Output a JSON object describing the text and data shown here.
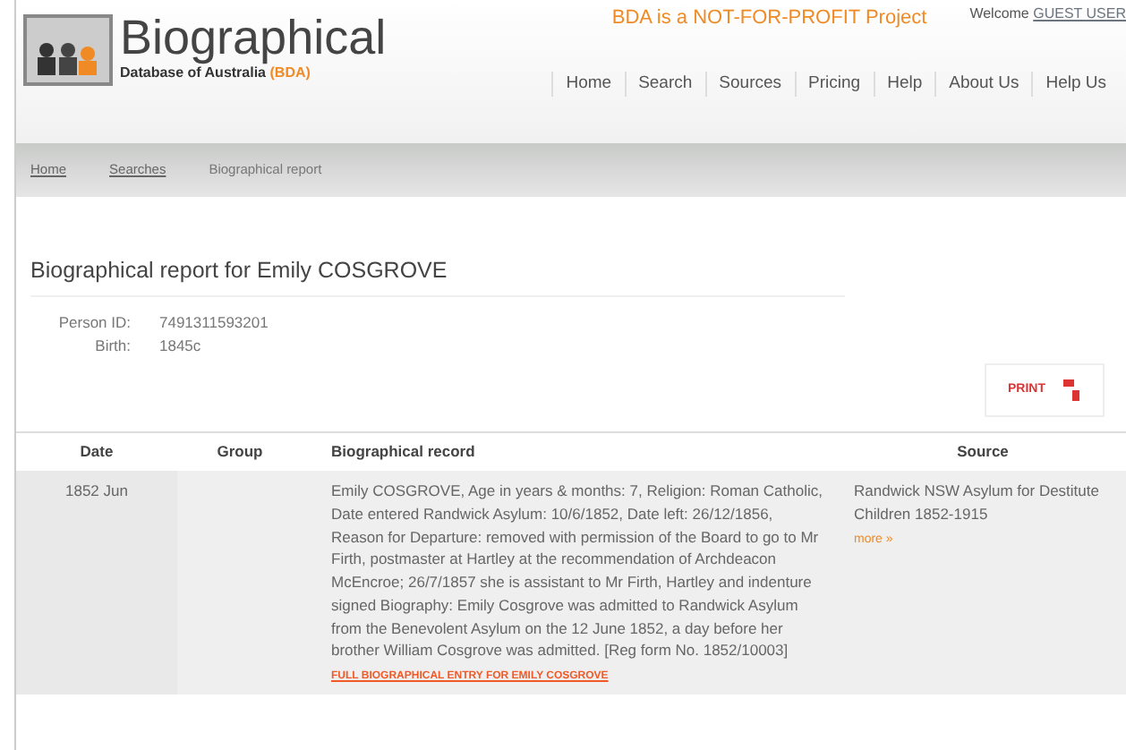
{
  "header": {
    "logo_title": "Biographical",
    "logo_subtitle": "Database of Australia",
    "logo_abbrev": "(BDA)",
    "tagline": "BDA is a NOT-FOR-PROFIT Project",
    "welcome": "Welcome",
    "user_link": "GUEST USER"
  },
  "nav": [
    {
      "label": "Home"
    },
    {
      "label": "Search"
    },
    {
      "label": "Sources"
    },
    {
      "label": "Pricing"
    },
    {
      "label": "Help"
    },
    {
      "label": "About Us"
    },
    {
      "label": "Help Us"
    }
  ],
  "breadcrumb": [
    {
      "label": "Home",
      "link": true
    },
    {
      "label": "Searches",
      "link": true
    },
    {
      "label": "Biographical report",
      "link": false
    }
  ],
  "title": "Biographical report for Emily COSGROVE",
  "details": [
    {
      "label": "Person ID:",
      "value": "7491311593201"
    },
    {
      "label": "Birth:",
      "value": "1845c"
    }
  ],
  "print_button": "PRINT",
  "table": {
    "columns": [
      "Date",
      "Group",
      "Biographical record",
      "Source"
    ],
    "rows": [
      {
        "date": "1852 Jun",
        "group": "",
        "record": "Emily COSGROVE, Age in years & months: 7, Religion: Roman Catholic, Date entered Randwick Asylum: 10/6/1852, Date left: 26/12/1856, Reason for Departure: removed with permission of the Board to go to Mr Firth, postmaster at Hartley at the recommendation of Archdeacon McEncroe; 26/7/1857 she is assistant to Mr Firth, Hartley and indenture signed Biography: Emily Cosgrove was admitted to Randwick Asylum from the Benevolent Asylum on the 12 June 1852, a day before her brother William Cosgrove was admitted. [Reg form No. 1852/10003]",
        "record_link": "FULL BIOGRAPHICAL ENTRY FOR EMILY COSGROVE",
        "source": "Randwick NSW Asylum for Destitute Children 1852-1915",
        "source_link": "more »"
      }
    ]
  }
}
